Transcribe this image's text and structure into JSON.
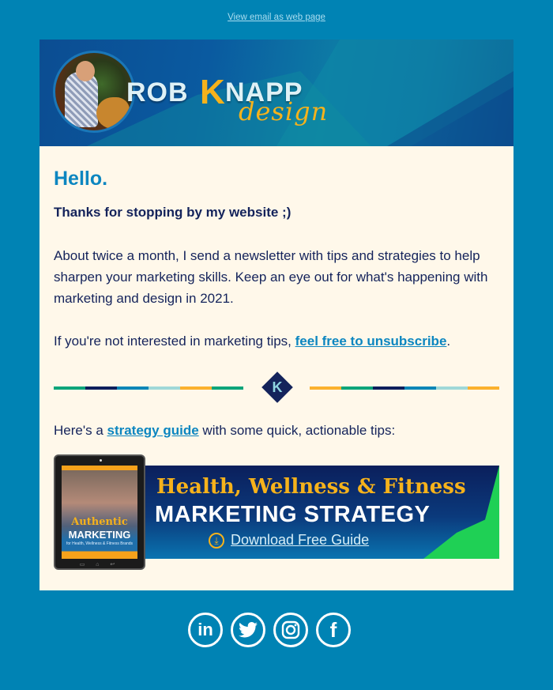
{
  "top_link": "View email as web page",
  "header": {
    "brand_first": "ROB",
    "brand_k": "K",
    "brand_last": "NAPP",
    "brand_script": "design"
  },
  "body": {
    "greeting": "Hello.",
    "subheading": "Thanks for stopping by my website ;)",
    "paragraph1": "About twice a month, I send a newsletter with tips and strategies to help sharpen your marketing skills. Keep an eye out for what's happening with marketing and design in 2021.",
    "paragraph2_prefix": "If you're not interested in marketing tips, ",
    "paragraph2_link": "feel free to unsubscribe",
    "paragraph2_suffix": ".",
    "paragraph3_prefix": "Here's a ",
    "paragraph3_link": "strategy guide",
    "paragraph3_suffix": " with some quick, actionable tips:"
  },
  "divider": {
    "logo_letter": "K",
    "left_colors": [
      "#0aa57a",
      "#0d1f5c",
      "#0a86b7",
      "#9fd8d8",
      "#fbb12e",
      "#0aa57a"
    ],
    "right_colors": [
      "#fbb12e",
      "#0aa57a",
      "#0d1f5c",
      "#0a86b7",
      "#9fd8d8",
      "#fbb12e"
    ]
  },
  "guide_banner": {
    "headline": "Health, Wellness & Fitness",
    "title": "MARKETING STRATEGY",
    "cta": "Download Free Guide",
    "ebook_title_1": "Authentic",
    "ebook_title_2": "MARKETING",
    "ebook_subtitle": "for Health, Wellness & Fitness Brands"
  },
  "social": [
    {
      "name": "linkedin",
      "glyph": "in"
    },
    {
      "name": "twitter",
      "glyph": "🐦"
    },
    {
      "name": "instagram",
      "glyph": "◎"
    },
    {
      "name": "facebook",
      "glyph": "f"
    }
  ],
  "colors": {
    "page_bg": "#0083b4",
    "card_bg": "#fff8ea",
    "heading_blue": "#0c86c0",
    "text_navy": "#14235b",
    "accent_orange": "#f6b21b"
  }
}
